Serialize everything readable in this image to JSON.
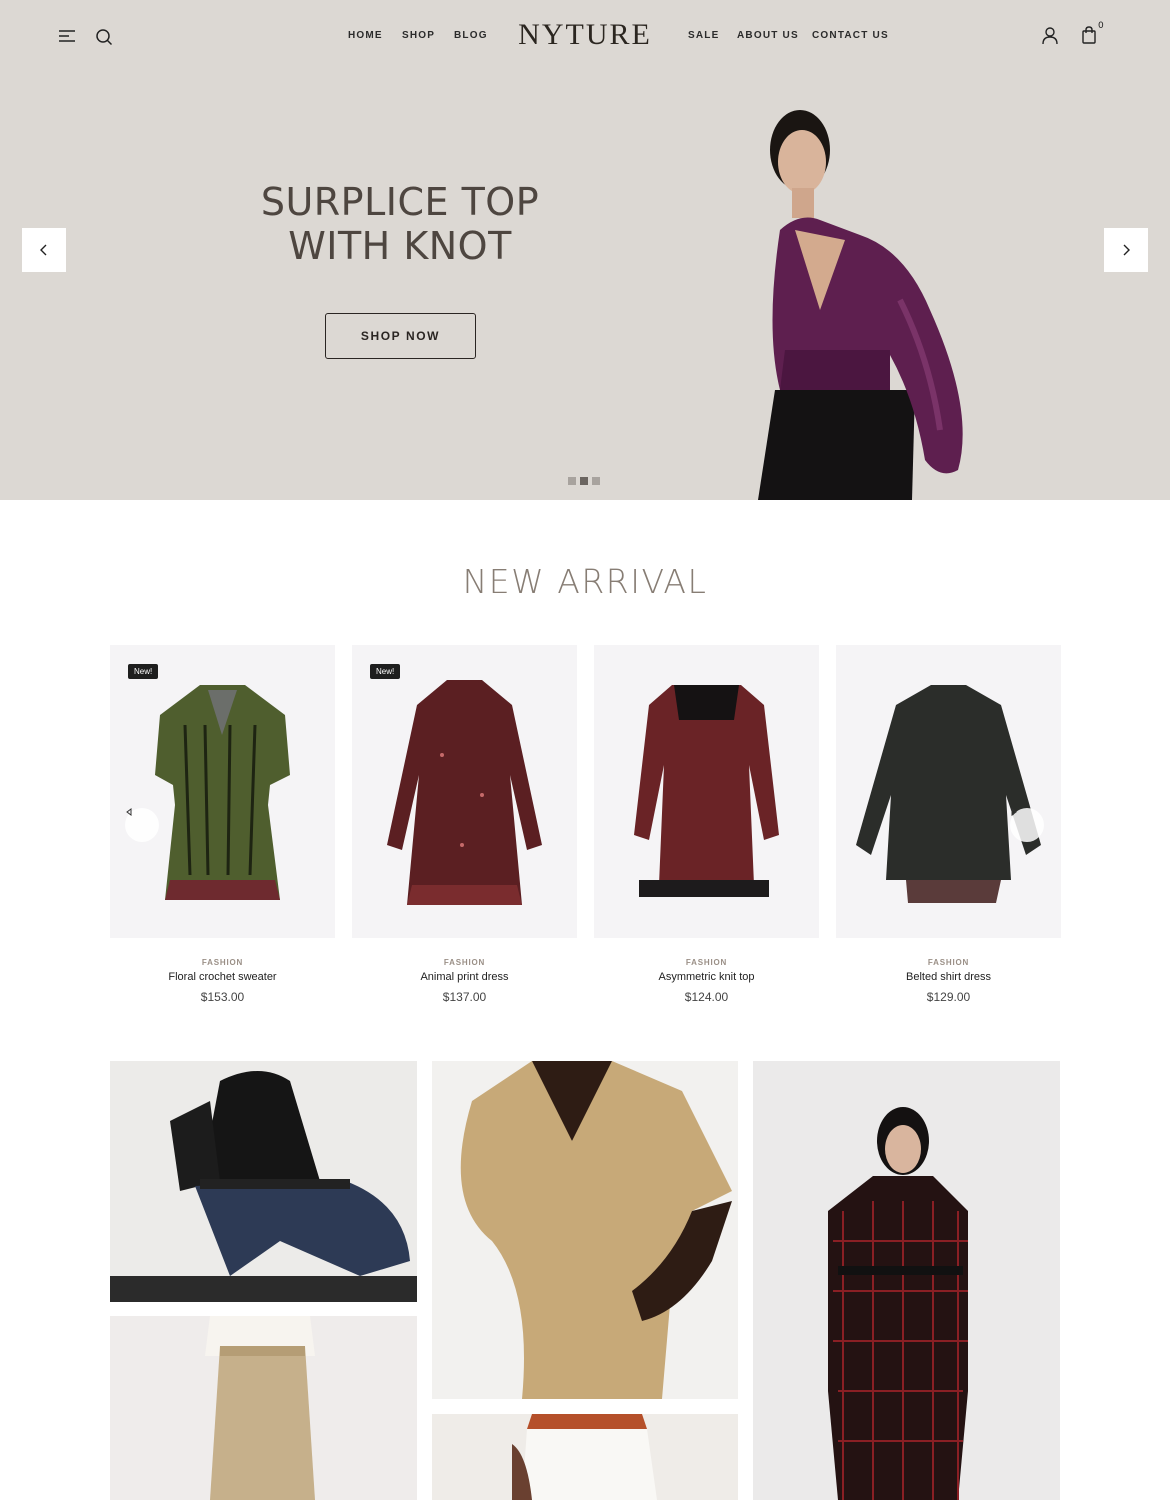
{
  "header": {
    "logo": "NYTURE",
    "nav_left": [
      "HOME",
      "SHOP",
      "BLOG"
    ],
    "nav_right": [
      "SALE",
      "ABOUT US",
      "CONTACT US"
    ],
    "cart_count": "0",
    "icons": [
      "menu-icon",
      "search-icon",
      "user-icon",
      "cart-icon"
    ]
  },
  "hero": {
    "title_line1": "SURPLICE TOP",
    "title_line2": "WITH KNOT",
    "button": "SHOP NOW",
    "slides": 3,
    "active_slide": 2,
    "background": "#dcd8d3"
  },
  "new_arrival": {
    "title": "NEW ARRIVAL",
    "products": [
      {
        "badge": "New!",
        "category": "FASHION",
        "name": "Floral crochet sweater",
        "price": "$153.00"
      },
      {
        "badge": "New!",
        "category": "FASHION",
        "name": "Animal print dress",
        "price": "$137.00"
      },
      {
        "badge": "",
        "category": "FASHION",
        "name": "Asymmetric knit top",
        "price": "$124.00"
      },
      {
        "badge": "",
        "category": "FASHION",
        "name": "Belted shirt dress",
        "price": "$129.00"
      }
    ]
  },
  "colors": {
    "accent_text": "#877d74",
    "dark": "#2a2522"
  }
}
